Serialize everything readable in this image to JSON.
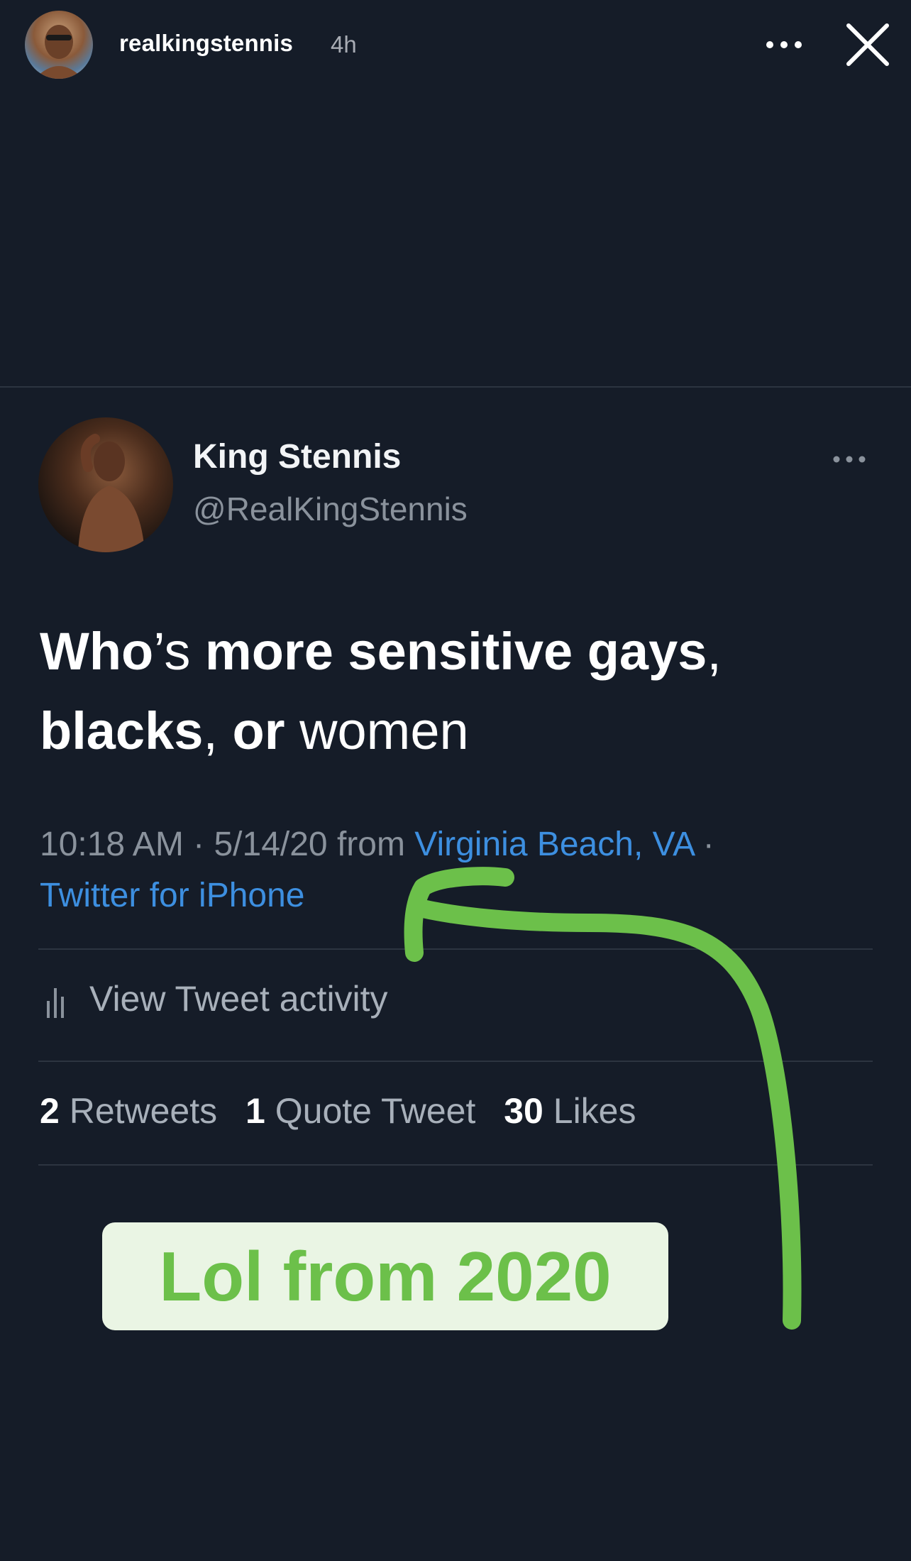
{
  "story": {
    "username": "realkingstennis",
    "time_ago": "4h"
  },
  "tweet": {
    "display_name": "King Stennis",
    "handle": "@RealKingStennis",
    "text_parts": {
      "p1": "Who",
      "p2": "’s ",
      "p3": "more sensitive gays",
      "p4": ",",
      "p5": "blacks",
      "p6": ", ",
      "p7": "or",
      "p8": " women"
    },
    "meta": {
      "time": "10:18 AM",
      "sep1": " · ",
      "date": "5/14/20",
      "from": " from ",
      "location": "Virginia Beach, VA",
      "sep2": " ·",
      "source": "Twitter for iPhone"
    },
    "activity_label": "View Tweet activity",
    "stats": {
      "retweets_count": "2",
      "retweets_label": " Retweets",
      "quotes_count": "1",
      "quotes_label": " Quote Tweet",
      "likes_count": "30",
      "likes_label": " Likes"
    }
  },
  "sticker": {
    "text": "Lol from 2020",
    "text_color": "#6cc04a",
    "bg_color": "#eaf5e4"
  },
  "colors": {
    "background": "#151c28",
    "link": "#3d8fe0",
    "muted": "#8a929c",
    "arrow": "#6cc04a"
  },
  "icons": {
    "more": "more-horizontal-icon",
    "close": "close-x-icon",
    "activity": "bar-chart-icon"
  }
}
